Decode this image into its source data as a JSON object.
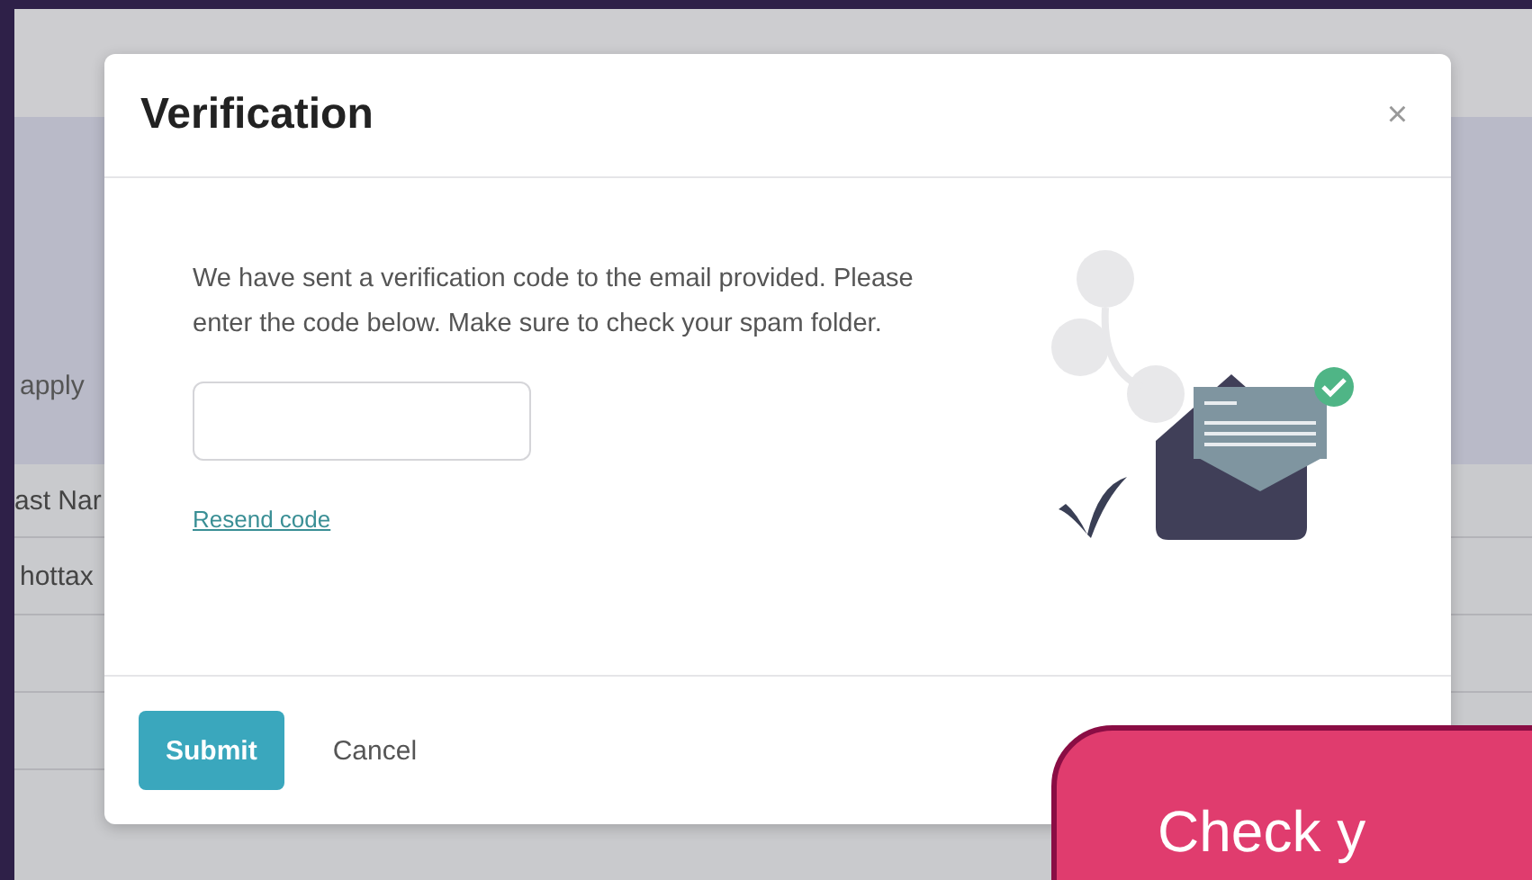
{
  "background_page": {
    "filter_text": "apply",
    "table": {
      "columns": [
        "ast Nar"
      ],
      "rows": [
        [
          "hottax"
        ]
      ]
    }
  },
  "dialog": {
    "title": "Verification",
    "close": "×",
    "message": "We have sent a verification code to the email provided. Please enter the code below. Make sure to check your spam folder.",
    "resend_link": "Resend code",
    "buttons": [
      {
        "label": "Submit",
        "kind": "primary"
      },
      {
        "label": "Cancel",
        "kind": "plain"
      }
    ]
  },
  "callout": {
    "text": "Check y"
  }
}
